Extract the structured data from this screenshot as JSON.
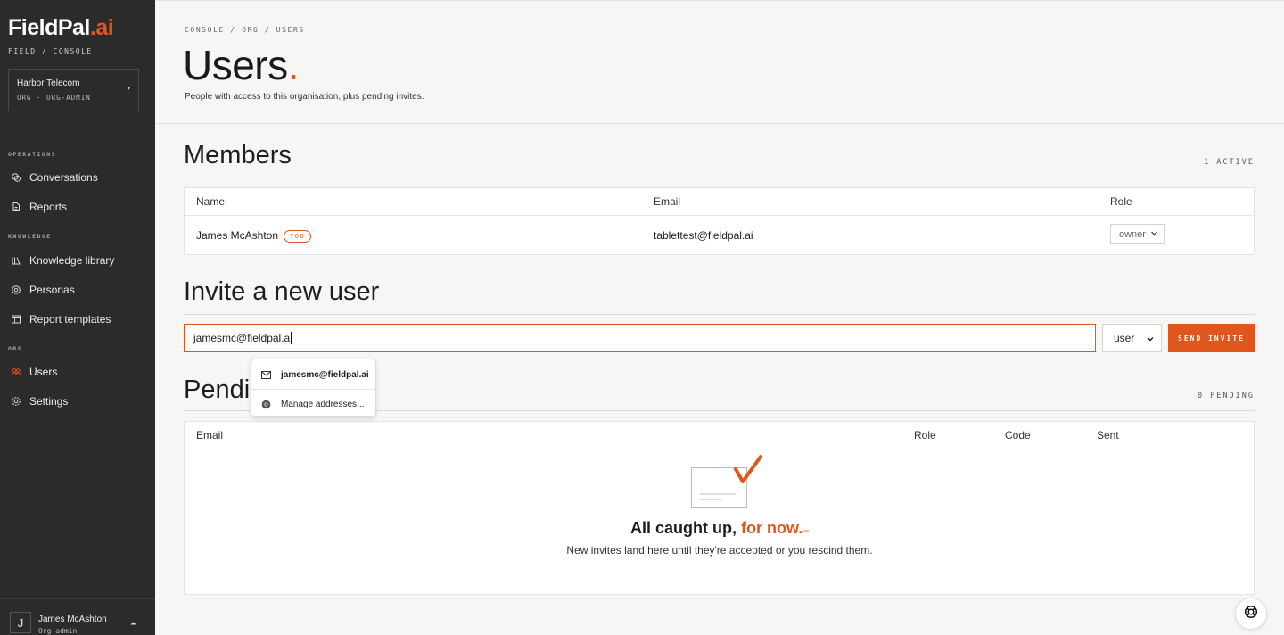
{
  "brand": {
    "name_main": "FieldPal",
    "name_accent": ".ai",
    "subtitle": "FIELD / CONSOLE",
    "accent_color": "#e0561d"
  },
  "org": {
    "name": "Harbor Telecom",
    "role": "ORG · ORG-ADMIN"
  },
  "sidebar": {
    "sections": [
      {
        "label": "OPERATIONS"
      },
      {
        "label": "KNOWLEDGE"
      },
      {
        "label": "ORG"
      }
    ],
    "items": [
      {
        "label": "Conversations",
        "icon": "chat-icon"
      },
      {
        "label": "Reports",
        "icon": "document-icon"
      },
      {
        "label": "Knowledge library",
        "icon": "library-icon"
      },
      {
        "label": "Personas",
        "icon": "persona-icon"
      },
      {
        "label": "Report templates",
        "icon": "template-icon"
      },
      {
        "label": "Users",
        "icon": "users-icon",
        "active": true
      },
      {
        "label": "Settings",
        "icon": "gear-icon"
      }
    ]
  },
  "current_user": {
    "initial": "J",
    "name": "James McAshton",
    "role": "Org admin"
  },
  "header": {
    "breadcrumb": "CONSOLE / ORG / USERS",
    "title": "Users",
    "title_dot": ".",
    "subtitle": "People with access to this organisation, plus pending invites."
  },
  "members": {
    "title": "Members",
    "count_label": "1 ACTIVE",
    "columns": [
      "Name",
      "Email",
      "Role"
    ],
    "rows": [
      {
        "name": "James McAshton",
        "badge": "YOU",
        "email": "tablettest@fieldpal.ai",
        "role": "owner"
      }
    ]
  },
  "invite": {
    "title": "Invite a new user",
    "email_value": "jamesmc@fieldpal.a",
    "role_value": "user",
    "send_label": "SEND INVITE"
  },
  "autocomplete": {
    "items": [
      {
        "label": "jamesmc@fieldpal.ai",
        "icon": "mail-icon"
      },
      {
        "label": "Manage addresses...",
        "icon": "chrome-icon"
      }
    ]
  },
  "pending": {
    "title_visible": "Pendin",
    "count_label": "0 PENDING",
    "columns": [
      "Email",
      "Role",
      "Code",
      "Sent"
    ],
    "empty_title_main": "All caught up,",
    "empty_title_accent": "for now.",
    "empty_title_tail": "–",
    "empty_subtitle": "New invites land here until they're accepted or you rescind them."
  }
}
